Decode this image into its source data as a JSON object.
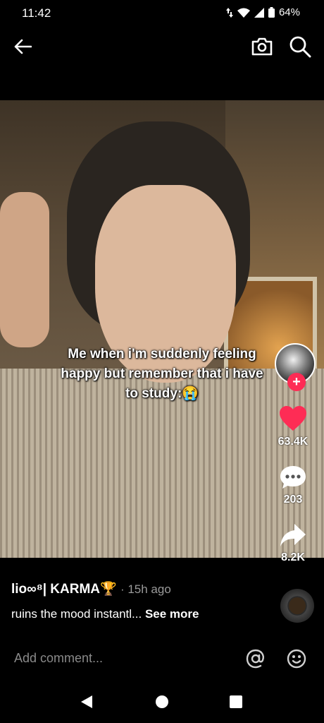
{
  "status_bar": {
    "time": "11:42",
    "battery": "64%"
  },
  "video": {
    "caption": "Me when i'm suddenly feeling happy but remember that i have to study:😭"
  },
  "actions": {
    "likes": "63.4K",
    "comments": "203",
    "shares": "8.2K"
  },
  "post": {
    "username": "lio∞⁸| KARMA🏆",
    "time_ago": "· 15h ago",
    "description": "ruins the mood instantl...",
    "see_more": "See more"
  },
  "comment_bar": {
    "placeholder": "Add comment..."
  },
  "colors": {
    "like": "#fe2c55",
    "background": "#000000"
  }
}
